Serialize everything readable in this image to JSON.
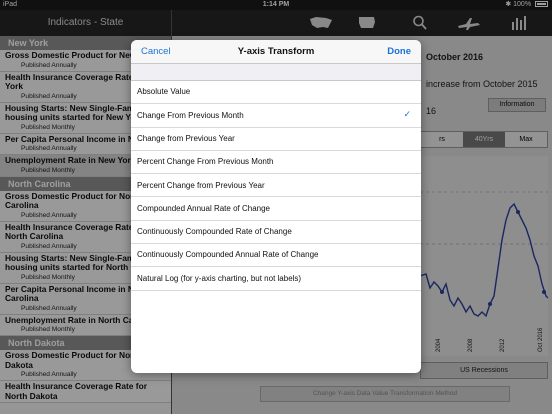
{
  "status": {
    "device": "iPad",
    "time": "1:14 PM",
    "battery": "100%"
  },
  "sidebar": {
    "title": "Indicators - State",
    "sections": [
      {
        "name": "New York",
        "items": [
          {
            "title": "Gross Domestic Product for New York",
            "sub": "Published Annually"
          },
          {
            "title": "Health Insurance Coverage Rate for New York",
            "sub": "Published Annually"
          },
          {
            "title": "Housing Starts: New Single-Family housing units started for New York",
            "sub": "Published Monthly"
          },
          {
            "title": "Per Capita Personal Income in New York",
            "sub": "Published Annually"
          },
          {
            "title": "Unemployment Rate in New York",
            "sub": "Published Monthly"
          }
        ]
      },
      {
        "name": "North Carolina",
        "items": [
          {
            "title": "Gross Domestic Product for North Carolina",
            "sub": "Published Annually"
          },
          {
            "title": "Health Insurance Coverage Rate for North Carolina",
            "sub": "Published Annually"
          },
          {
            "title": "Housing Starts: New Single-Family housing units started for North Carolina",
            "sub": "Published Monthly"
          },
          {
            "title": "Per Capita Personal Income in North Carolina",
            "sub": "Published Annually"
          },
          {
            "title": "Unemployment Rate in North Carolina",
            "sub": "Published Monthly"
          }
        ]
      },
      {
        "name": "North Dakota",
        "items": [
          {
            "title": "Gross Domestic Product for North Dakota",
            "sub": "Published Annually"
          },
          {
            "title": "Health Insurance Coverage Rate for North Dakota",
            "sub": ""
          }
        ]
      }
    ]
  },
  "main": {
    "title_fragment": "October 2016",
    "line_fragment": "increase from October 2015",
    "num_fragment": "16",
    "information_button": "Information",
    "range": {
      "left": "rs",
      "mid": "40Yrs",
      "max": "Max"
    },
    "x_ticks": [
      "2004",
      "2008",
      "2012",
      "Oct 2016"
    ],
    "recessions_button": "US Recessions",
    "bottom_button": "Change Y-axis Data Value Transformation Method"
  },
  "modal": {
    "cancel": "Cancel",
    "title": "Y-axis Transform",
    "done": "Done",
    "options": [
      {
        "label": "Absolute Value",
        "checked": false
      },
      {
        "label": "Change From Previous Month",
        "checked": true
      },
      {
        "label": "Change from Previous Year",
        "checked": false
      },
      {
        "label": "Percent Change From Previous Month",
        "checked": false
      },
      {
        "label": "Percent Change from Previous Year",
        "checked": false
      },
      {
        "label": "Compounded Annual Rate of Change",
        "checked": false
      },
      {
        "label": "Continuously Compounded Rate of Change",
        "checked": false
      },
      {
        "label": "Continuously Compounded Annual Rate of Change",
        "checked": false
      },
      {
        "label": "Natural Log (for y-axis charting, but not labels)",
        "checked": false
      }
    ]
  },
  "colors": {
    "accent": "#1a73d9",
    "toolbar": "#262626",
    "section": "#8e8e8e"
  },
  "icons": [
    "us-map-icon",
    "state-map-icon",
    "search-icon",
    "plane-icon",
    "data-bars-icon"
  ]
}
